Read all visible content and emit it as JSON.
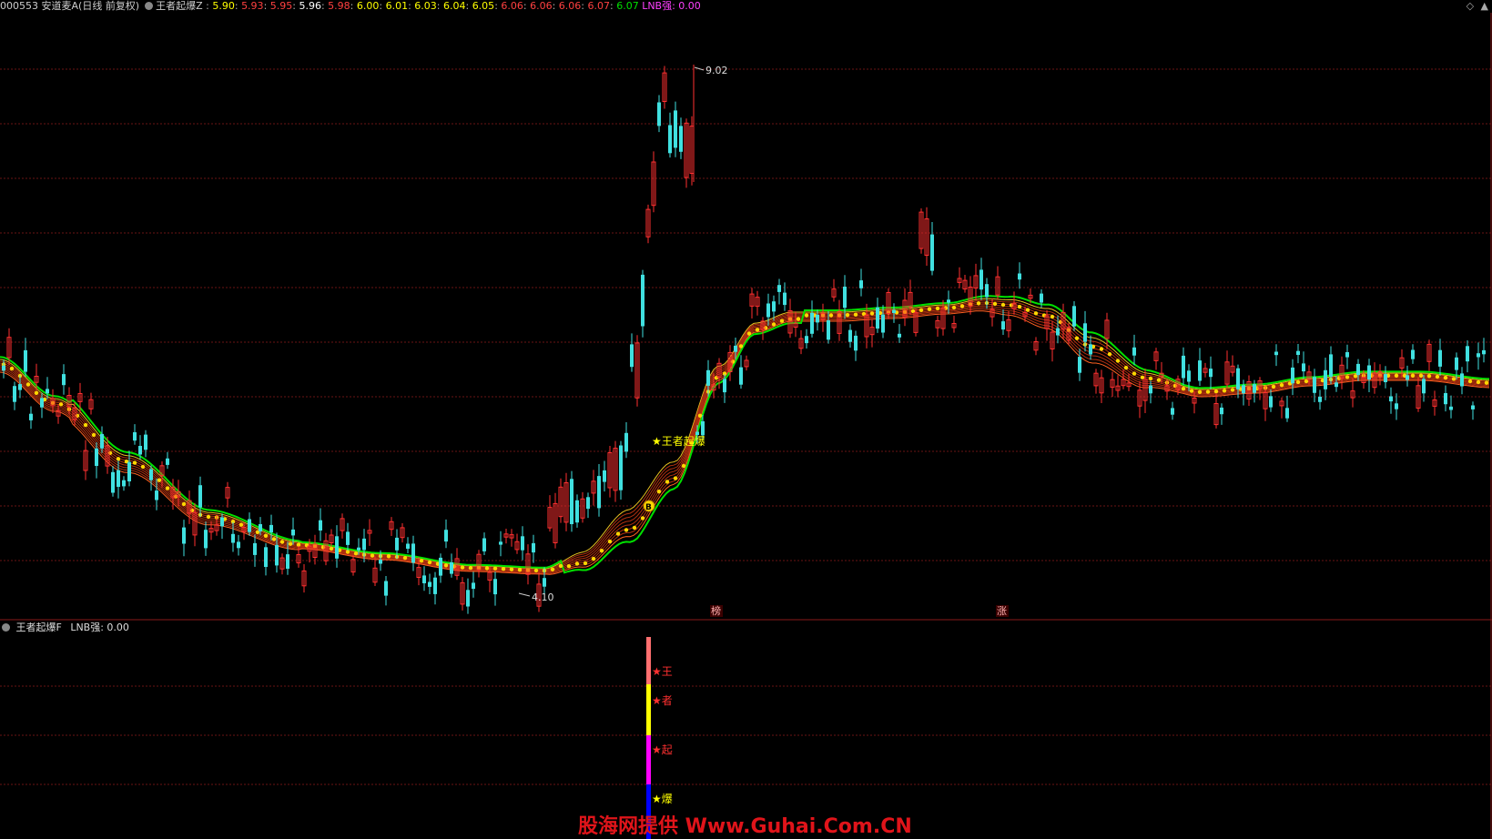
{
  "header": {
    "code": "000553",
    "name": "安道麦A(日线 前复权)",
    "indicator": "王者起爆Z",
    "values": [
      "5.90",
      "5.93",
      "5.95",
      "5.96",
      "5.98",
      "6.00",
      "6.01",
      "6.03",
      "6.04",
      "6.05",
      "6.06",
      "6.06",
      "6.06",
      "6.07",
      "6.07"
    ],
    "value_colors": [
      "#ffff00",
      "#ff4040",
      "#ff4040",
      "#ffffff",
      "#ff4040",
      "#ffff00",
      "#ffff00",
      "#ffff00",
      "#ffff00",
      "#ffff00",
      "#ff4040",
      "#ff4040",
      "#ff4040",
      "#ff4040",
      "#00e000"
    ],
    "lnb_label": "LNB强: 0.00"
  },
  "lower_header": {
    "indicator": "王者起爆F",
    "lnb_label": "LNB强: 0.00"
  },
  "chart_data": {
    "type": "candlestick",
    "high_label": "9.02",
    "low_label": "4.10",
    "signal_label": "★王者起爆",
    "signal_mark": "B",
    "markers": [
      "榜",
      "涨"
    ],
    "lower_signals": [
      "★王",
      "★者",
      "★起",
      "★爆"
    ],
    "lower_bar_colors": [
      "#ff7070",
      "#ffff00",
      "#ff00ff",
      "#0000ff"
    ],
    "colors": {
      "up": "#ff3030",
      "down": "#40e0e0",
      "ma_outer": "#00e000",
      "ma_dots": "#ffd700",
      "ribbon": "#b03010"
    }
  },
  "watermark": "股海网提供 Www.Guhai.Com.CN"
}
